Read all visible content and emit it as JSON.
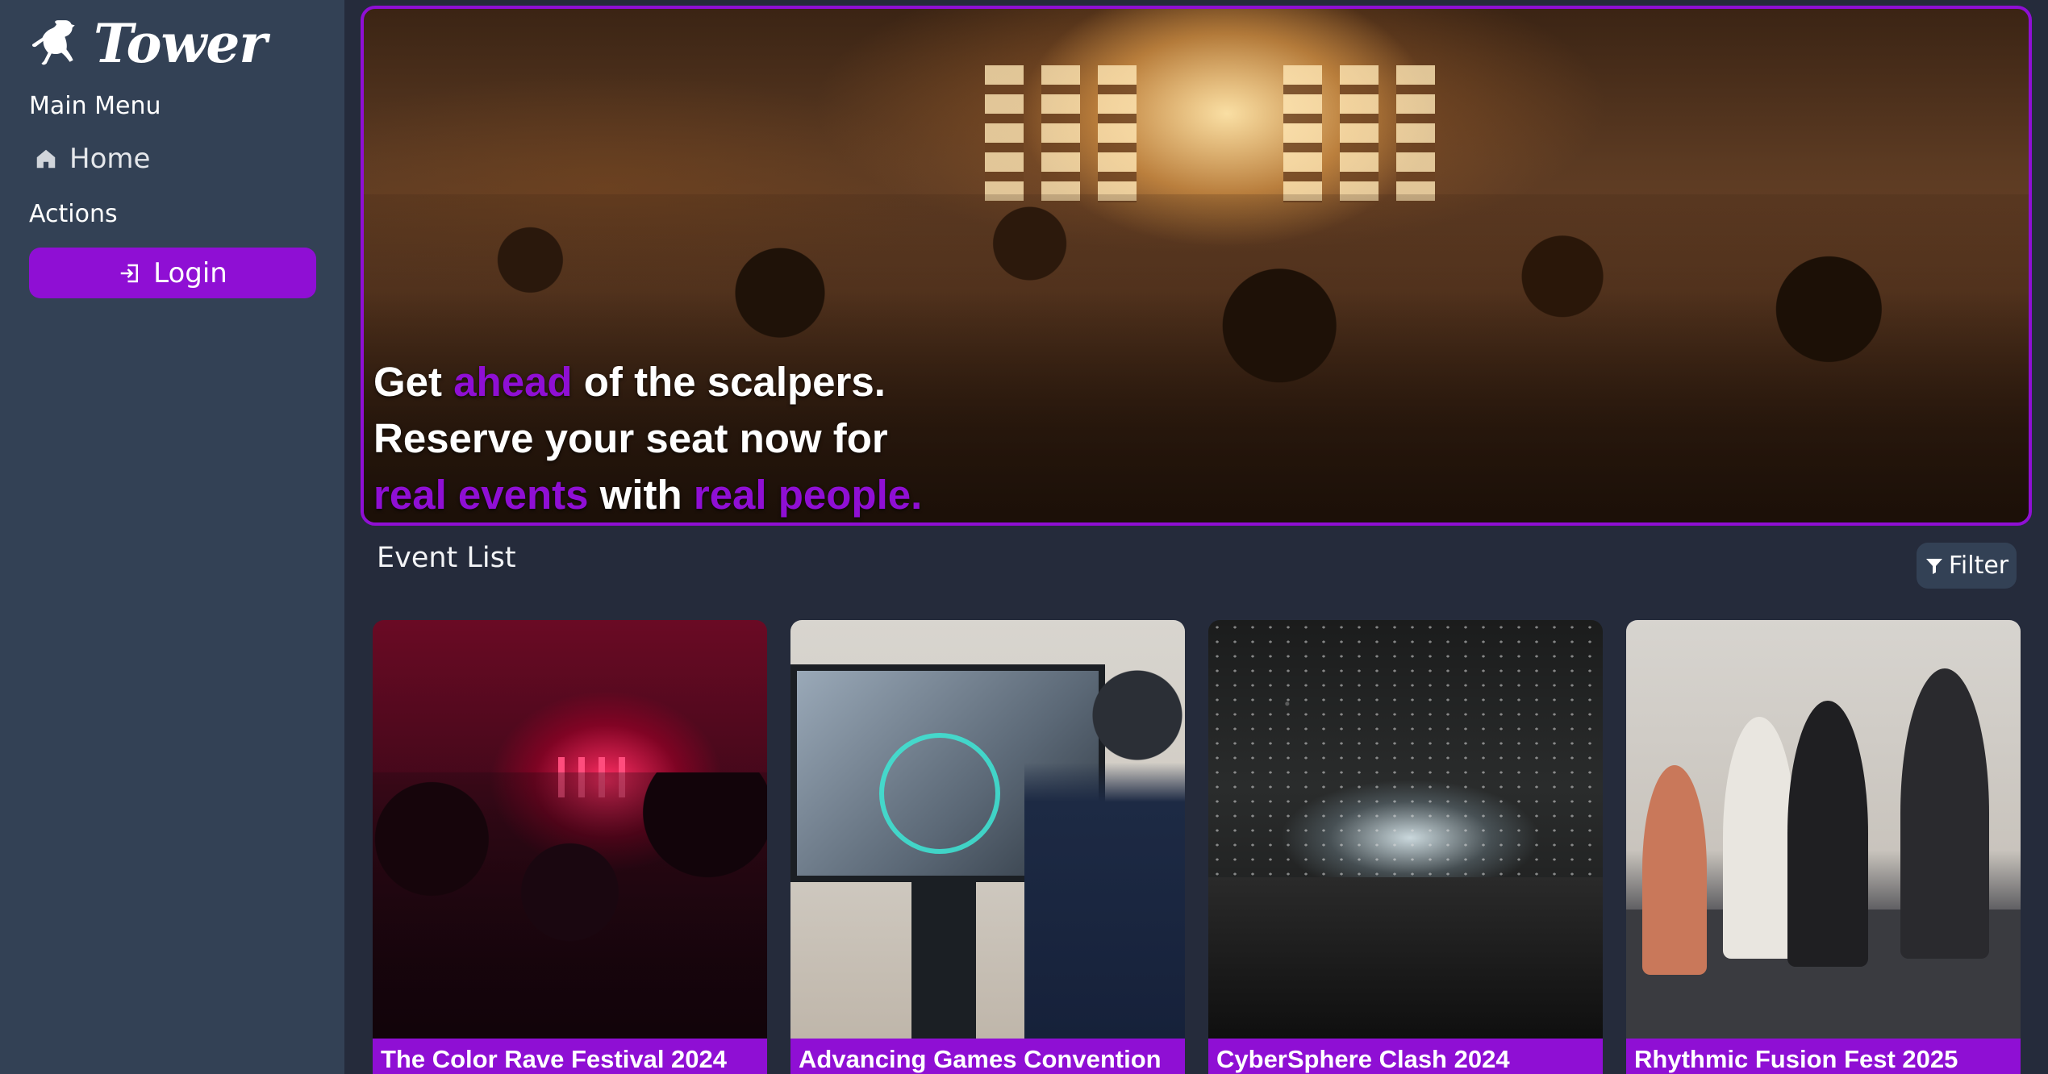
{
  "sidebar": {
    "brand": {
      "name": "Tower",
      "logo_icon": "kangaroo-icon"
    },
    "main_menu_label": "Main Menu",
    "home": {
      "label": "Home",
      "icon": "home-icon"
    },
    "actions_label": "Actions",
    "login": {
      "label": "Login",
      "icon": "login-icon"
    }
  },
  "hero": {
    "line1_part1": "Get ",
    "line1_accent": "ahead",
    "line1_part2": " of the scalpers.",
    "line2": "Reserve your seat now for",
    "line3_accent1": "real events",
    "line3_mid": " with ",
    "line3_accent2": "real people."
  },
  "event_list": {
    "title": "Event List",
    "filter_label": "Filter",
    "filter_icon": "filter-icon",
    "events": [
      {
        "title": "The Color Rave Festival 2024"
      },
      {
        "title": "Advancing Games Convention"
      },
      {
        "title": "CyberSphere Clash 2024"
      },
      {
        "title": "Rhythmic Fusion Fest 2025"
      }
    ]
  },
  "colors": {
    "accent": "#8f0fd4",
    "sidebar_bg": "#334155",
    "page_bg": "#252b3b"
  }
}
